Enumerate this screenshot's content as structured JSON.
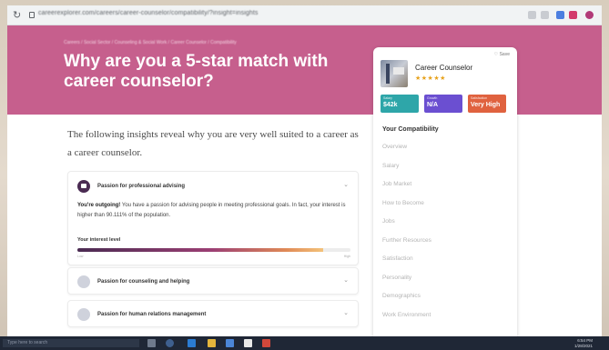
{
  "browser": {
    "url": "careerexplorer.com/careers/career-counselor/compatibility/?insight=insights",
    "reload_glyph": "↻"
  },
  "hero": {
    "breadcrumb": "Careers / Social Sector / Counseling & Social Work / Career Counselor / Compatibility",
    "title": "Why are you a 5-star match with career counselor?"
  },
  "main": {
    "intro": "The following insights reveal why you are very well suited to a career as a career counselor.",
    "insight_cards": [
      {
        "title": "Passion for professional advising",
        "expanded": true,
        "body_strong": "You're outgoing!",
        "body_text": " You have a passion for advising people in meeting professional goals. In fact, your interest is higher than 90.111% of the population.",
        "level_label": "Your interest level",
        "level_percent": 90.111,
        "scale_left": "Low",
        "scale_right": "High"
      },
      {
        "title": "Passion for counseling and helping",
        "expanded": false
      },
      {
        "title": "Passion for human relations management",
        "expanded": false
      }
    ],
    "chevron_glyph": "⌄"
  },
  "side_card": {
    "save_label": "♡ Save",
    "job_title": "Career Counselor",
    "stars": "★★★★★",
    "stats": [
      {
        "key": "Salary",
        "value": "$42k",
        "color": "#2ea6a9"
      },
      {
        "key": "Growth",
        "value": "N/A",
        "color": "#6b4fd1"
      },
      {
        "key": "Satisfaction",
        "value": "Very High",
        "color": "#e0623f"
      }
    ],
    "section_heading": "Your Compatibility",
    "nav_items": [
      "Overview",
      "Salary",
      "Job Market",
      "How to Become",
      "Jobs",
      "Further Resources",
      "Satisfaction",
      "Personality",
      "Demographics",
      "Work Environment"
    ]
  },
  "taskbar": {
    "search_placeholder": "Type here to search",
    "time": "6:54 PM",
    "date": "1/28/2021"
  },
  "colors": {
    "hero_bg": "#c65f8d",
    "accent_dark": "#4a2b52",
    "star": "#e7a21c"
  },
  "icons": [
    "reload-icon",
    "lock-icon",
    "passion-icon",
    "chevron-down-icon",
    "windows-icon",
    "edge-icon",
    "explorer-icon"
  ]
}
